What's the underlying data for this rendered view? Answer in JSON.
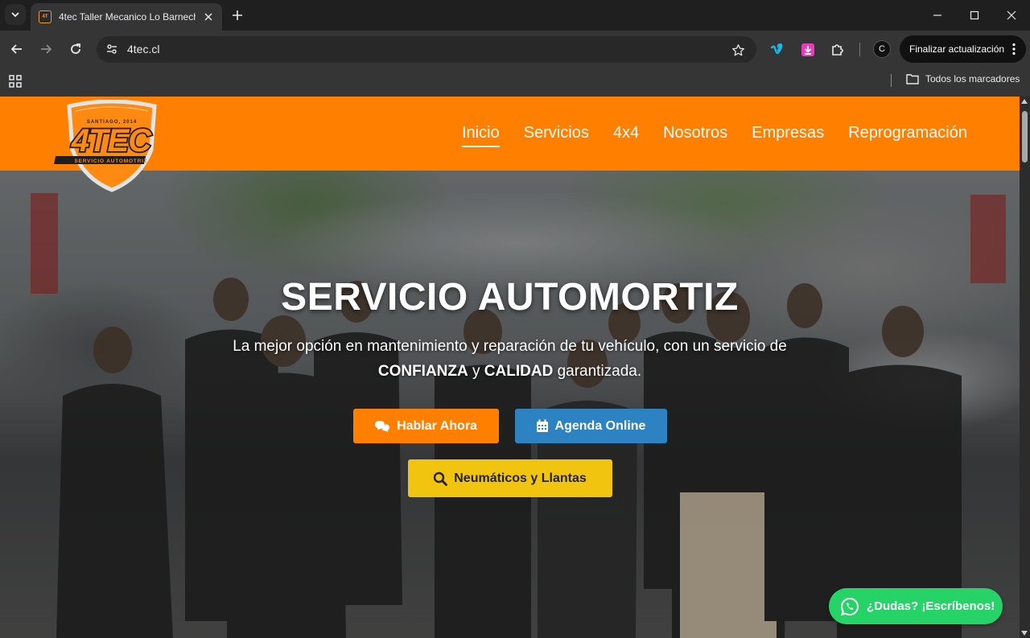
{
  "browser": {
    "tab_title": "4tec Taller Mecanico Lo Barnechea",
    "url": "4tec.cl",
    "update_button": "Finalizar actualización",
    "profile_initial": "C",
    "bookmarks_all": "Todos los marcadores"
  },
  "header": {
    "logo_top": "SANTIAGO, 2014",
    "logo_main": "4TEC",
    "logo_bottom": "SERVICIO AUTOMOTRIZ",
    "nav": [
      "Inicio",
      "Servicios",
      "4x4",
      "Nosotros",
      "Empresas",
      "Reprogramación"
    ],
    "active_nav": "Inicio"
  },
  "hero": {
    "title": "SERVICIO AUTOMORTIZ",
    "text_line1": "La mejor opción en mantenimiento y reparación de tu vehículo, con un servicio de",
    "text_bold1": "CONFIANZA",
    "text_join": "y",
    "text_bold2": "CALIDAD",
    "text_end": "garantizada.",
    "btn_chat": "Hablar Ahora",
    "btn_agenda": "Agenda Online",
    "btn_tires": "Neumáticos y Llantas"
  },
  "whatsapp": {
    "label": "¿Dudas? ¡Escríbenos!"
  },
  "colors": {
    "brand_orange": "#ff7f00",
    "agenda_blue": "#2d83c1",
    "tires_yellow": "#f1c40f",
    "whatsapp_green": "#25d366"
  }
}
